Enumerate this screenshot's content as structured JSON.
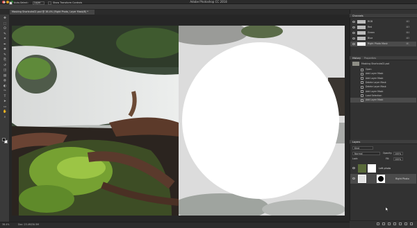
{
  "window": {
    "title": "Adobe Photoshop CC 2018"
  },
  "options_bar": {
    "auto_select_label": "Auto-Select:",
    "auto_select_value": "Layer",
    "show_transform_label": "Show Transform Controls"
  },
  "document_tab": {
    "label": "Masking Shortcuts02.psd @ 38.4% (Right Photo, Layer Mask/8) *"
  },
  "toolbar": {
    "tools": [
      "move-icon",
      "marquee-icon",
      "lasso-icon",
      "quick-select-icon",
      "crop-icon",
      "eyedropper-icon",
      "healing-icon",
      "brush-icon",
      "stamp-icon",
      "history-brush-icon",
      "eraser-icon",
      "gradient-icon",
      "blur-icon",
      "dodge-icon",
      "pen-icon",
      "type-icon",
      "path-select-icon",
      "shape-icon",
      "hand-icon",
      "zoom-icon"
    ],
    "glyphs": [
      "✥",
      "⬚",
      "ʘ",
      "✎",
      "⌗",
      "✒",
      "✚",
      "✎",
      "⎘",
      "↺",
      "◫",
      "▤",
      "◍",
      "◐",
      "✑",
      "T",
      "➤",
      "▭",
      "✋",
      "⌕",
      "⋯"
    ],
    "foreground_color": "#000000",
    "background_color": "#ffffff"
  },
  "status_bar": {
    "zoom": "38.4%",
    "doc_info": "Doc: 23.4M/30.5M"
  },
  "channels_panel": {
    "tab": "Channels",
    "rows": [
      {
        "label": "RGB",
        "shortcut": "⌘2"
      },
      {
        "label": "Red",
        "shortcut": "⌘3"
      },
      {
        "label": "Green",
        "shortcut": "⌘4"
      },
      {
        "label": "Blue",
        "shortcut": "⌘5"
      },
      {
        "label": "Right Photo Mask",
        "shortcut": "⌘\\"
      }
    ]
  },
  "history_panel": {
    "tabs": [
      "History",
      "Properties"
    ],
    "snapshot": "Masking Shortcuts02.psd",
    "states": [
      "Open",
      "Add Layer Mask",
      "Add Layer Mask",
      "Delete Layer Mask",
      "Delete Layer Mask",
      "Add Layer Mask",
      "Load Selection",
      "Add Layer Mask"
    ]
  },
  "layers_panel": {
    "tab": "Layers",
    "kind_label": "Kind",
    "blend_mode": "Normal",
    "opacity_label": "Opacity:",
    "opacity_value": "100%",
    "lock_label": "Lock:",
    "fill_label": "Fill:",
    "fill_value": "100%",
    "layers": [
      {
        "name": "Left photo"
      },
      {
        "name": "Right Photo"
      }
    ]
  },
  "colors": {
    "accent": "#3b6eb4",
    "panel": "#323232",
    "mask_white": "#ffffff"
  }
}
